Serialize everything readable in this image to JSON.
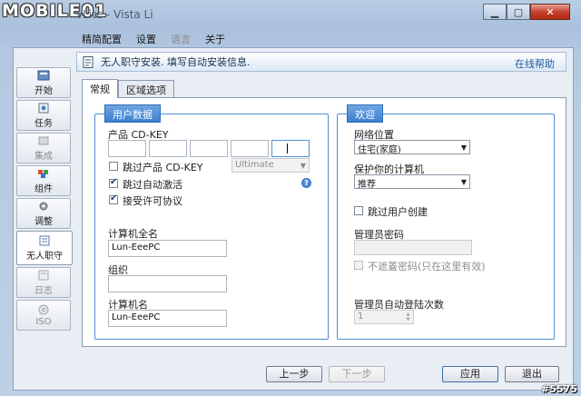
{
  "watermark_logo": "MOBILE01",
  "window": {
    "title": "vLite - Vista Li"
  },
  "menu": [
    "精简配置",
    "设置",
    "语言",
    "关于"
  ],
  "nav": [
    {
      "label": "开始",
      "icon": "start-icon",
      "state": "enabled"
    },
    {
      "label": "任务",
      "icon": "tasks-icon",
      "state": "enabled"
    },
    {
      "label": "集成",
      "icon": "integrate-icon",
      "state": "disabled"
    },
    {
      "label": "组件",
      "icon": "components-icon",
      "state": "enabled"
    },
    {
      "label": "调整",
      "icon": "tweaks-icon",
      "state": "enabled"
    },
    {
      "label": "无人职守",
      "icon": "unattended-icon",
      "state": "active"
    },
    {
      "label": "日志",
      "icon": "log-icon",
      "state": "disabled"
    },
    {
      "label": "ISO",
      "icon": "iso-icon",
      "state": "disabled"
    }
  ],
  "banner": {
    "text": "无人职守安装. 填写自动安装信息.",
    "help": "在线帮助"
  },
  "tabs": [
    {
      "label": "常规"
    },
    {
      "label": "区域选项"
    }
  ],
  "user_group": {
    "title": "用户数据",
    "cdkey_label": "产品 CD-KEY",
    "skip_key": "跳过产品 CD-KEY",
    "edition": "Ultimate",
    "skip_activation": "跳过自动激活",
    "accept_eula": "接受许可协议",
    "full_name_label": "计算机全名",
    "full_name_value": "Lun-EeePC",
    "org_label": "组织",
    "org_value": "",
    "computer_name_label": "计算机名",
    "computer_name_value": "Lun-EeePC"
  },
  "welcome_group": {
    "title": "欢迎",
    "network_label": "网络位置",
    "network_value": "住宅(家庭)",
    "protect_label": "保护你的计算机",
    "protect_value": "推荐",
    "skip_user": "跳过用户创建",
    "admin_pw_label": "管理员密码",
    "no_overwrite": "不遮蓋密码(只在这里有效)",
    "autologon_label": "管理员自动登陆次数",
    "autologon_value": "1"
  },
  "buttons": {
    "prev": "上一步",
    "next": "下一步",
    "apply": "应用",
    "exit": "退出"
  },
  "watermark": "#5575"
}
